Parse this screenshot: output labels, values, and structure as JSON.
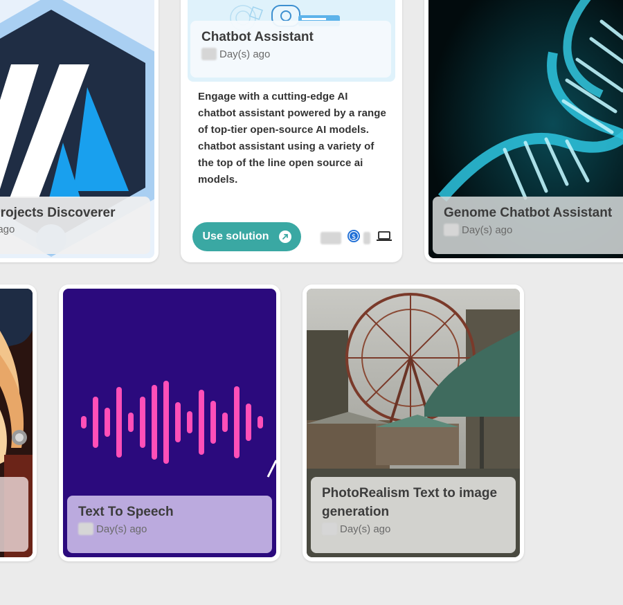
{
  "cards": {
    "projects": {
      "title": "Projects Discoverer",
      "meta": "Day(s) ago"
    },
    "chatbot": {
      "title": "Chatbot Assistant",
      "meta": "Day(s) ago",
      "description": "Engage with a cutting-edge AI chatbot assistant powered by a range of top-tier open-source AI models. chatbot assistant using a variety of the top of the line open source ai models.",
      "button_label": "Use solution",
      "icons": [
        "dollar-circle-icon",
        "laptop-icon",
        "external-arrow-icon"
      ]
    },
    "genome": {
      "title": "Genome Chatbot Assistant",
      "meta": "Day(s) ago"
    },
    "anime": {
      "title": "",
      "meta": ""
    },
    "tts": {
      "title": "Text To Speech",
      "meta": "Day(s) ago"
    },
    "photorealism": {
      "title": "PhotoRealism Text to image generation",
      "meta": "Day(s) ago"
    }
  },
  "colors": {
    "page_bg": "#ebebeb",
    "button": "#3aa8a3",
    "tts_bg": "#2b0a7d",
    "wave": "#ff4fb8"
  }
}
